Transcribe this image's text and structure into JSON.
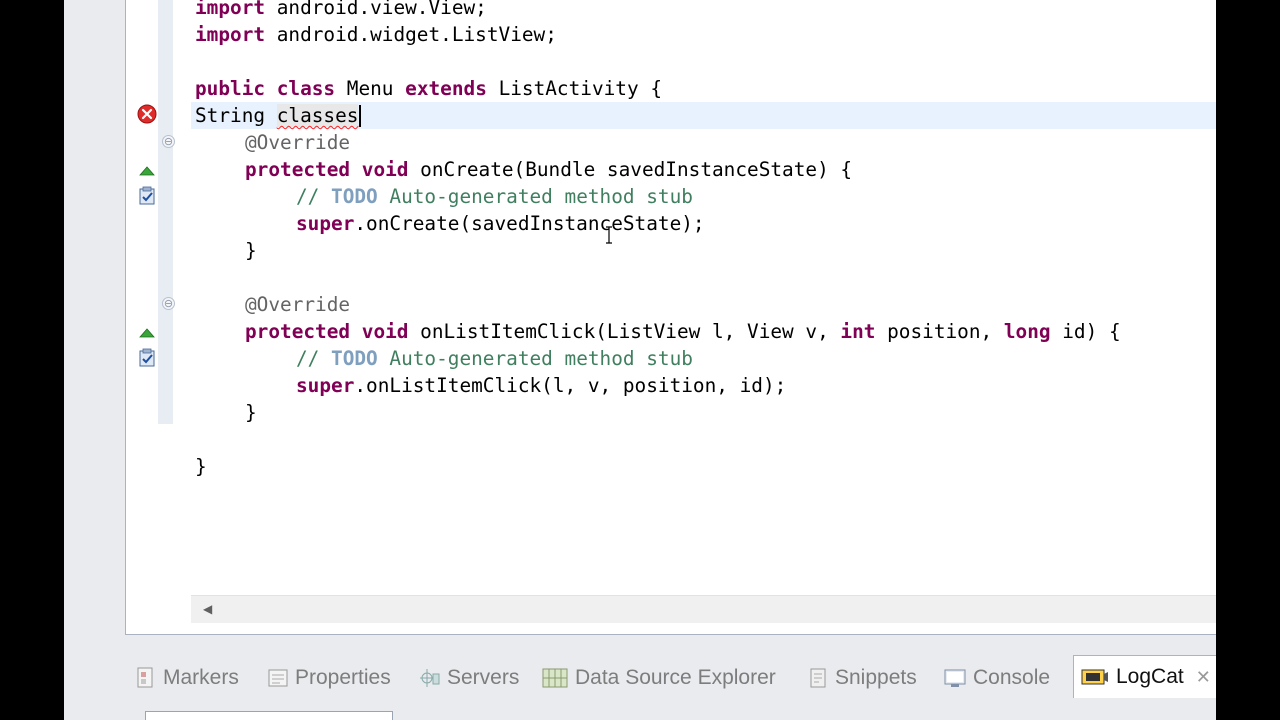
{
  "editor": {
    "lines": {
      "l1": {
        "kw": "import",
        "rest": " android.view.View;"
      },
      "l2": {
        "kw": "import",
        "rest": " android.widget.ListView;"
      },
      "l3": {
        "kw1": "public",
        "kw2": "class",
        "mid": " Menu ",
        "kw3": "extends",
        "rest": " ListActivity {"
      },
      "l4": {
        "pre": "String ",
        "err": "classes"
      },
      "l5": {
        "ann": "@Override"
      },
      "l6": {
        "kw1": "protected",
        "kw2": "void",
        "rest": " onCreate(Bundle savedInstanceState) {"
      },
      "l7": {
        "cmt": "// ",
        "todo": "TODO",
        "cmt2": " Auto-generated method stub"
      },
      "l8": {
        "kw": "super",
        "rest": ".onCreate(savedInstanceState);"
      },
      "l9": {
        "brace": "}"
      },
      "l10": {
        "ann": "@Override"
      },
      "l11": {
        "kw1": "protected",
        "kw2": "void",
        "mid": " onListItemClick(ListView l, View v, ",
        "kw3": "int",
        "mid2": " position, ",
        "kw4": "long",
        "rest": " id) {"
      },
      "l12": {
        "cmt": "// ",
        "todo": "TODO",
        "cmt2": " Auto-generated method stub"
      },
      "l13": {
        "kw": "super",
        "rest": ".onListItemClick(l, v, position, id);"
      },
      "l14": {
        "brace": "}"
      },
      "l15": {
        "brace": "}"
      }
    },
    "fold_symbol": "⊖",
    "scroll_left": "◀"
  },
  "bottom_panel": {
    "tabs": [
      {
        "label": "Markers",
        "icon": "markers-icon"
      },
      {
        "label": "Properties",
        "icon": "properties-icon"
      },
      {
        "label": "Servers",
        "icon": "servers-icon"
      },
      {
        "label": "Data Source Explorer",
        "icon": "data-source-explorer-icon"
      },
      {
        "label": "Snippets",
        "icon": "snippets-icon"
      },
      {
        "label": "Console",
        "icon": "console-icon"
      },
      {
        "label": "LogCat",
        "icon": "logcat-icon",
        "active": true
      }
    ],
    "close_symbol": "✕"
  },
  "colors": {
    "keyword": "#7f0055",
    "annotation": "#646464",
    "comment": "#3f7f5f",
    "todo": "#7f9fbf",
    "current_line": "#e8f2fe",
    "error": "#e02020"
  }
}
